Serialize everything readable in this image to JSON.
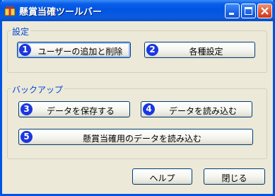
{
  "window": {
    "title": "懸賞当確ツールバー"
  },
  "settings_group": {
    "label": "設定",
    "buttons": [
      {
        "number": "1",
        "label": "ユーザーの追加と削除"
      },
      {
        "number": "2",
        "label": "各種設定"
      }
    ]
  },
  "backup_group": {
    "label": "バックアップ",
    "buttons": [
      {
        "number": "3",
        "label": "データを保存する"
      },
      {
        "number": "4",
        "label": "データを読み込む"
      },
      {
        "number": "5",
        "label": "懸賞当確用のデータを読み込む"
      }
    ]
  },
  "footer": {
    "help_label": "ヘルプ",
    "close_label": "閉じる"
  },
  "colors": {
    "title_bar": "#0054e3",
    "number_badge": "#1a37e0",
    "group_label": "#0046d5"
  }
}
